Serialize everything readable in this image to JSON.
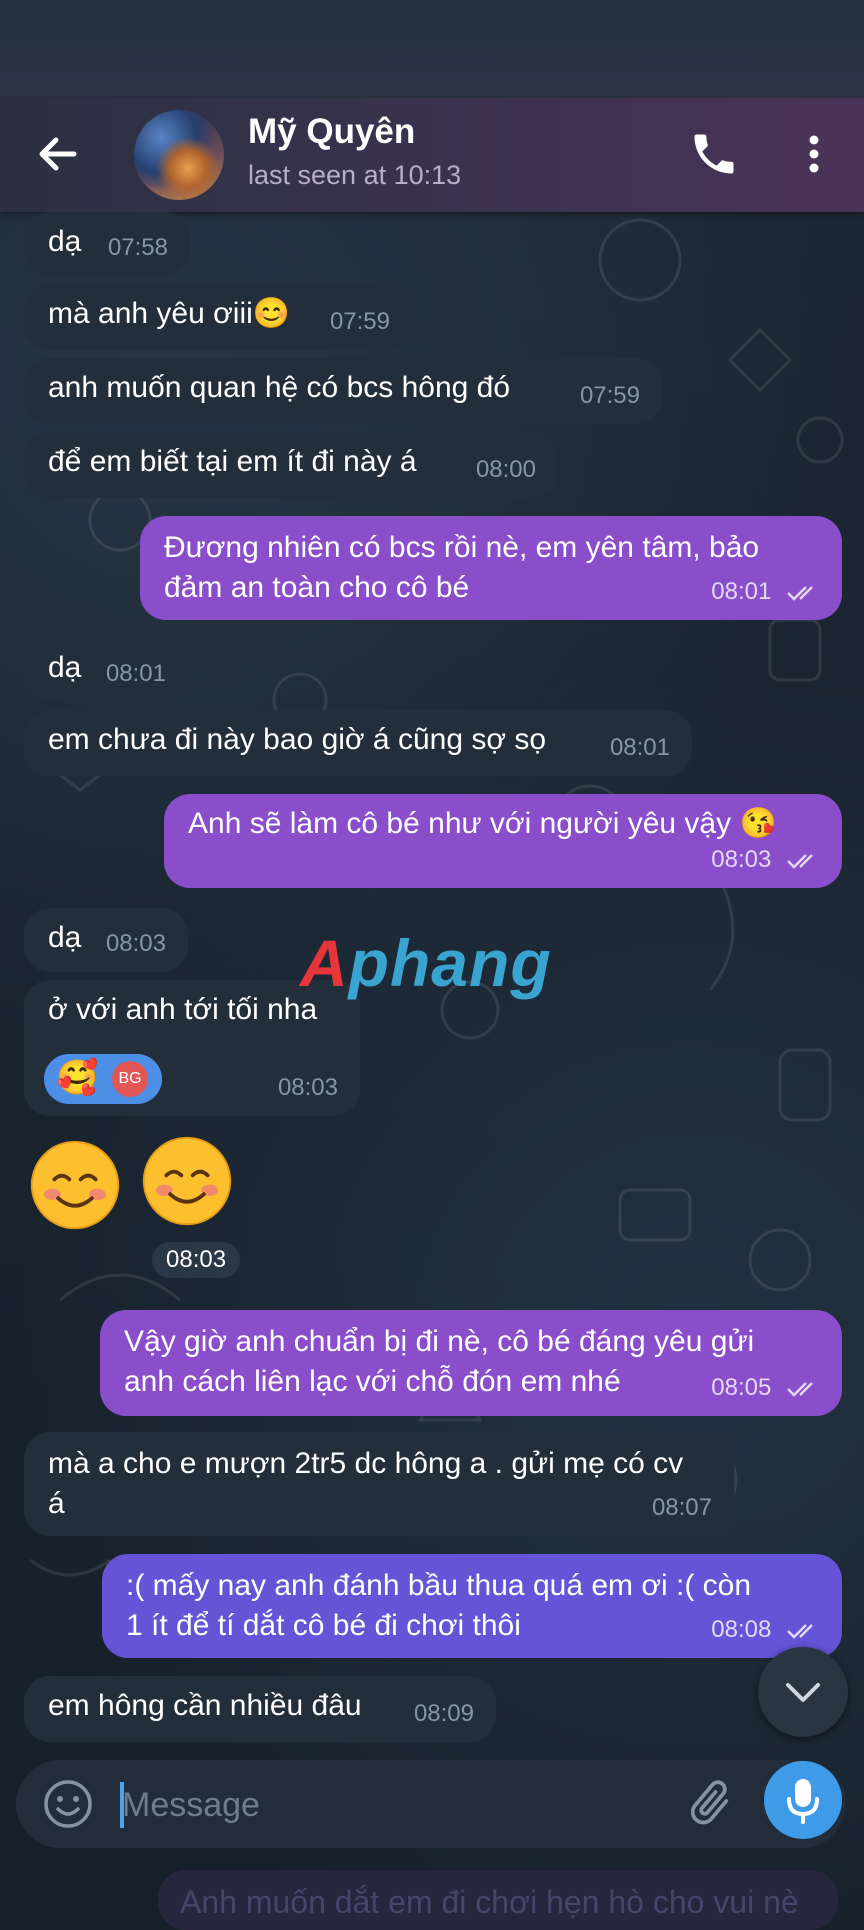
{
  "header": {
    "contact_name": "Mỹ Quyên",
    "status": "last seen at 10:13"
  },
  "messages": [
    {
      "dir": "in",
      "text": "dạ",
      "time": "07:58"
    },
    {
      "dir": "in",
      "text": "mà anh yêu ơiii😊",
      "time": "07:59"
    },
    {
      "dir": "in",
      "text": "anh muốn quan hệ có bcs hông đó",
      "time": "07:59"
    },
    {
      "dir": "in",
      "text": "để em biết tại em ít đi này á",
      "time": "08:00"
    },
    {
      "dir": "out",
      "text": "Đương nhiên có bcs rồi nè, em yên tâm, bảo đảm an toàn cho cô bé",
      "time": "08:01"
    },
    {
      "dir": "in",
      "text": "dạ",
      "time": "08:01"
    },
    {
      "dir": "in",
      "text": "em chưa đi này bao giờ á cũng sợ sọ",
      "time": "08:01"
    },
    {
      "dir": "out",
      "text": "Anh sẽ làm cô bé như với người yêu vậy 😘",
      "time": "08:03"
    },
    {
      "dir": "in",
      "text": "dạ",
      "time": "08:03"
    },
    {
      "dir": "in",
      "text": "ở với anh tới tối nha",
      "time": "08:03",
      "reaction_avatar": "BG",
      "reaction_emoji": "🥰"
    },
    {
      "dir": "in",
      "text": "😊 😊",
      "time": "08:03",
      "kind": "emoji"
    },
    {
      "dir": "out",
      "text": "Vậy giờ anh chuẩn bị đi nè, cô bé đáng yêu gửi anh cách liên lạc với chỗ đón em nhé",
      "time": "08:05"
    },
    {
      "dir": "in",
      "text": "mà a cho e mượn 2tr5 dc hông a . gửi mẹ có cv á",
      "time": "08:07"
    },
    {
      "dir": "out",
      "text": ":( mấy nay anh đánh bầu thua quá em ơi :( còn 1 ít để tí dắt cô bé đi chơi thôi",
      "time": "08:08"
    },
    {
      "dir": "in",
      "text": "em hông cần nhiều đâu",
      "time": "08:09"
    }
  ],
  "watermark": {
    "a": "A",
    "rest": "phang"
  },
  "input": {
    "placeholder": "Message"
  },
  "faded_preview": "Anh muốn dắt em đi chơi hẹn hò cho vui nè",
  "icons": {
    "back": "back-arrow-icon",
    "call": "phone-icon",
    "more": "more-vert-icon",
    "emoji": "emoji-icon",
    "attach": "paperclip-icon",
    "mic": "mic-icon",
    "scroll": "chevron-down-icon"
  },
  "colors": {
    "incoming": "#222e3a",
    "outgoing": "#8a4ecb",
    "outgoing_alt": "#6554d6",
    "accent": "#3f9ae8"
  }
}
